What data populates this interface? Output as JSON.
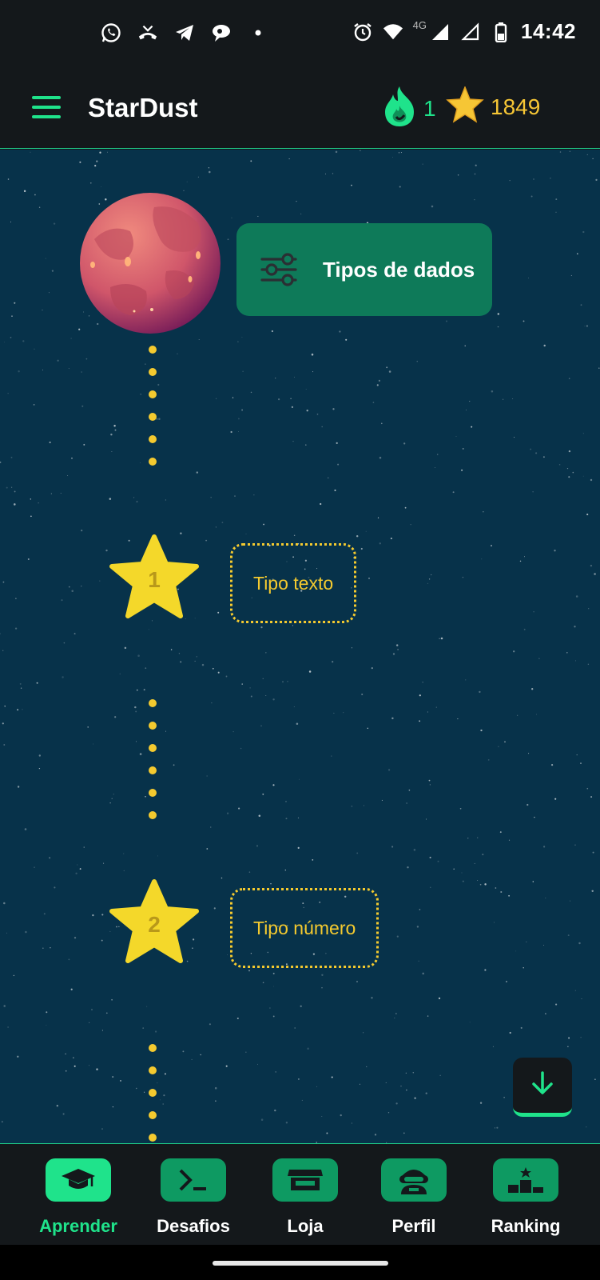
{
  "status_bar": {
    "time": "14:42",
    "network": "4G",
    "left_icons": [
      "whatsapp-icon",
      "missed-call-icon",
      "telegram-icon",
      "chat-bubble-icon",
      "dot-icon"
    ],
    "right_icons": [
      "alarm-icon",
      "wifi-icon",
      "signal-icon",
      "signal-empty-icon",
      "battery-icon"
    ]
  },
  "app_bar": {
    "title": "StarDust",
    "streak_count": "1",
    "stars_count": "1849",
    "colors": {
      "accent": "#1fe38b",
      "gold": "#f6c635"
    }
  },
  "map": {
    "unit": {
      "title": "Tipos de dados",
      "icon": "sliders-icon"
    },
    "lessons": [
      {
        "number": "1",
        "title": "Tipo texto"
      },
      {
        "number": "2",
        "title": "Tipo número"
      }
    ],
    "scroll_button_icon": "arrow-down-icon",
    "colors": {
      "background": "#07324a",
      "card": "#0e7a59",
      "star": "#f4ca2f"
    }
  },
  "bottom_nav": {
    "items": [
      {
        "label": "Aprender",
        "icon": "graduation-cap-icon",
        "active": true
      },
      {
        "label": "Desafios",
        "icon": "terminal-icon",
        "active": false
      },
      {
        "label": "Loja",
        "icon": "store-icon",
        "active": false
      },
      {
        "label": "Perfil",
        "icon": "astronaut-icon",
        "active": false
      },
      {
        "label": "Ranking",
        "icon": "podium-icon",
        "active": false
      }
    ]
  }
}
